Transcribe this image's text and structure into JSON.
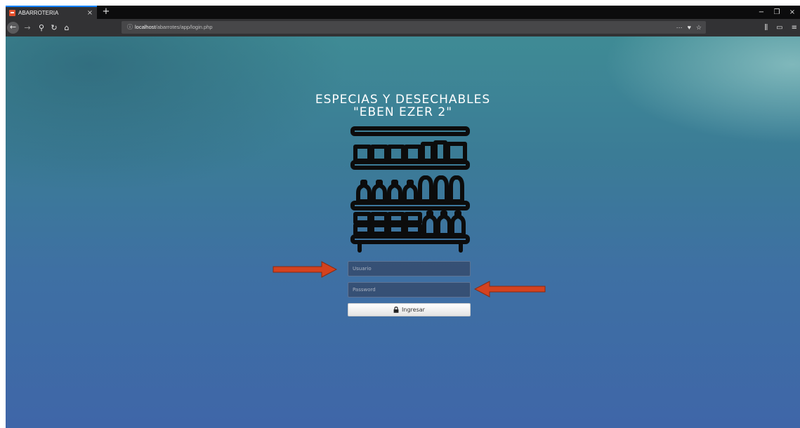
{
  "tab": {
    "title": "ABARROTERIA",
    "close": "×",
    "new_tab": "+"
  },
  "window_controls": {
    "minimize": "−",
    "restore": "❐",
    "close": "×"
  },
  "nav": {
    "back": "←",
    "forward": "→",
    "tools": "⚲",
    "reload": "↻",
    "home": "⌂",
    "url_info": "ⓘ",
    "url_host": "localhost",
    "url_path": "/abarrotes/app/login.php",
    "url_more": "···",
    "url_pocket": "♥",
    "url_star": "☆",
    "library": "⫼",
    "sidebar": "▭",
    "menu": "≡"
  },
  "page": {
    "title_line1": "ESPECIAS Y DESECHABLES",
    "title_line2": "\"EBEN EZER 2\"",
    "username_placeholder": "Usuario",
    "password_placeholder": "Password",
    "login_label": "Ingresar",
    "shelf_icon": "store-shelf-icon"
  },
  "colors": {
    "arrow": "#d4421f",
    "tab_accent": "#0a84ff",
    "button_text": "#333333"
  }
}
